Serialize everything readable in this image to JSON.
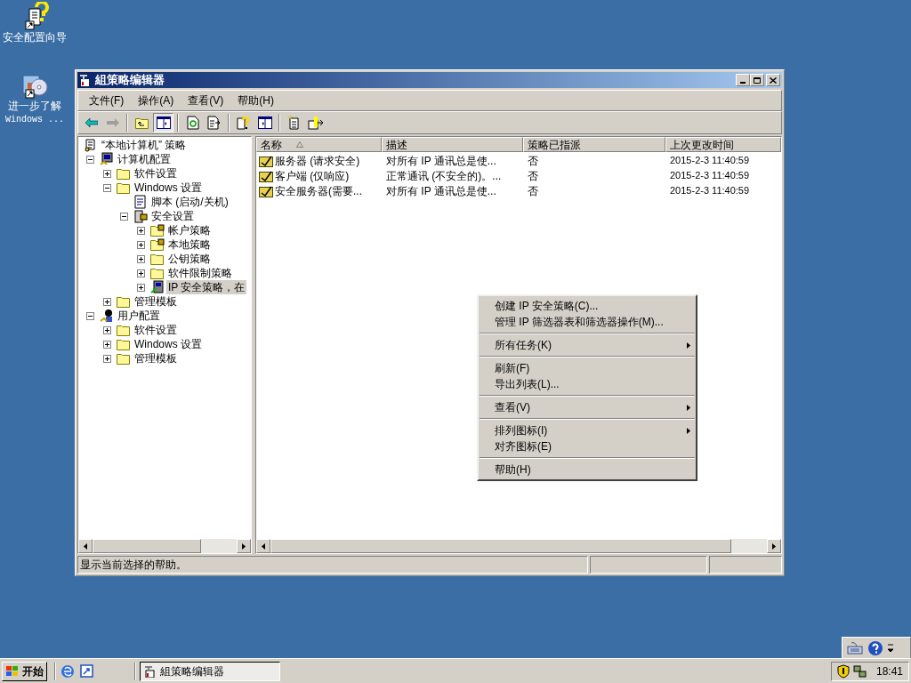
{
  "desktop_icons": [
    {
      "kind": "wizard",
      "lines": [
        "安全配置向导"
      ]
    },
    {
      "kind": "cd",
      "lines": [
        "进一步了解",
        "Windows ..."
      ]
    }
  ],
  "window": {
    "title": "組策略编辑器",
    "active": true
  },
  "menu_bar": [
    "文件(F)",
    "操作(A)",
    "查看(V)",
    "帮助(H)"
  ],
  "toolbar": [
    {
      "kind": "back",
      "pressed": false,
      "disabled": false
    },
    {
      "kind": "forward",
      "pressed": false,
      "disabled": true
    },
    {
      "kind": "sep"
    },
    {
      "kind": "up",
      "pressed": false,
      "disabled": false
    },
    {
      "kind": "tree",
      "pressed": true,
      "disabled": false
    },
    {
      "kind": "sep"
    },
    {
      "kind": "refresh",
      "pressed": false,
      "disabled": false
    },
    {
      "kind": "export",
      "pressed": false,
      "disabled": false
    },
    {
      "kind": "sep"
    },
    {
      "kind": "help",
      "pressed": false,
      "disabled": false
    },
    {
      "kind": "pane",
      "pressed": false,
      "disabled": false
    },
    {
      "kind": "sep"
    },
    {
      "kind": "new",
      "pressed": false,
      "disabled": false
    },
    {
      "kind": "import",
      "pressed": false,
      "disabled": false
    }
  ],
  "tree": {
    "label": "“本地计算机” 策略",
    "kind": "policy",
    "selected": false,
    "children": [
      {
        "label": "计算机配置",
        "kind": "computer",
        "expanded": true,
        "selected": false,
        "children": [
          {
            "label": "软件设置",
            "kind": "folder",
            "expanded": false,
            "selected": false
          },
          {
            "label": "Windows 设置",
            "kind": "folder",
            "expanded": true,
            "selected": false,
            "children": [
              {
                "label": "脚本 (启动/关机)",
                "kind": "script",
                "selected": false
              },
              {
                "label": "安全设置",
                "kind": "security",
                "expanded": true,
                "selected": false,
                "children": [
                  {
                    "label": "帐户策略",
                    "kind": "lockfolder",
                    "expanded": false,
                    "selected": false
                  },
                  {
                    "label": "本地策略",
                    "kind": "lockfolder",
                    "expanded": false,
                    "selected": false
                  },
                  {
                    "label": "公钥策略",
                    "kind": "folder",
                    "expanded": false,
                    "selected": false
                  },
                  {
                    "label": "软件限制策略",
                    "kind": "folder",
                    "expanded": false,
                    "selected": false
                  },
                  {
                    "label": "IP 安全策略，在",
                    "kind": "ip",
                    "expanded": false,
                    "selected": true
                  }
                ]
              }
            ]
          },
          {
            "label": "管理模板",
            "kind": "folder",
            "expanded": false,
            "selected": false
          }
        ]
      },
      {
        "label": "用户配置",
        "kind": "user",
        "expanded": true,
        "selected": false,
        "children": [
          {
            "label": "软件设置",
            "kind": "folder",
            "expanded": false,
            "selected": false
          },
          {
            "label": "Windows 设置",
            "kind": "folder",
            "expanded": false,
            "selected": false
          },
          {
            "label": "管理模板",
            "kind": "folder",
            "expanded": false,
            "selected": false
          }
        ]
      }
    ]
  },
  "list": {
    "columns": [
      {
        "label": "名称",
        "sorted": true
      },
      {
        "label": "描述",
        "sorted": false
      },
      {
        "label": "策略已指派",
        "sorted": false
      },
      {
        "label": "上次更改时间",
        "sorted": false
      }
    ],
    "rows": [
      {
        "name": "服务器 (请求安全)",
        "description": "对所有 IP 通讯总是使...",
        "assigned": "否",
        "modified": "2015-2-3 11:40:59"
      },
      {
        "name": "客户端 (仅响应)",
        "description": "正常通讯 (不安全的)。...",
        "assigned": "否",
        "modified": "2015-2-3 11:40:59"
      },
      {
        "name": "安全服务器(需要...",
        "description": "对所有 IP 通讯总是使...",
        "assigned": "否",
        "modified": "2015-2-3 11:40:59"
      }
    ]
  },
  "status_bar": "显示当前选择的帮助。",
  "context_menu": [
    {
      "kind": "item",
      "label": "创建 IP 安全策略(C)...",
      "submenu": false
    },
    {
      "kind": "item",
      "label": "管理 IP 筛选器表和筛选器操作(M)...",
      "submenu": false
    },
    {
      "kind": "separator"
    },
    {
      "kind": "item",
      "label": "所有任务(K)",
      "submenu": true
    },
    {
      "kind": "separator"
    },
    {
      "kind": "item",
      "label": "刷新(F)",
      "submenu": false
    },
    {
      "kind": "item",
      "label": "导出列表(L)...",
      "submenu": false
    },
    {
      "kind": "separator"
    },
    {
      "kind": "item",
      "label": "查看(V)",
      "submenu": true
    },
    {
      "kind": "separator"
    },
    {
      "kind": "item",
      "label": "排列图标(I)",
      "submenu": true
    },
    {
      "kind": "item",
      "label": "对齐图标(E)",
      "submenu": false
    },
    {
      "kind": "separator"
    },
    {
      "kind": "item",
      "label": "帮助(H)",
      "submenu": false
    }
  ],
  "taskbar": {
    "start": "开始",
    "tasks": [
      {
        "label": "組策略编辑器",
        "pressed": true
      }
    ],
    "clock": "18:41"
  }
}
